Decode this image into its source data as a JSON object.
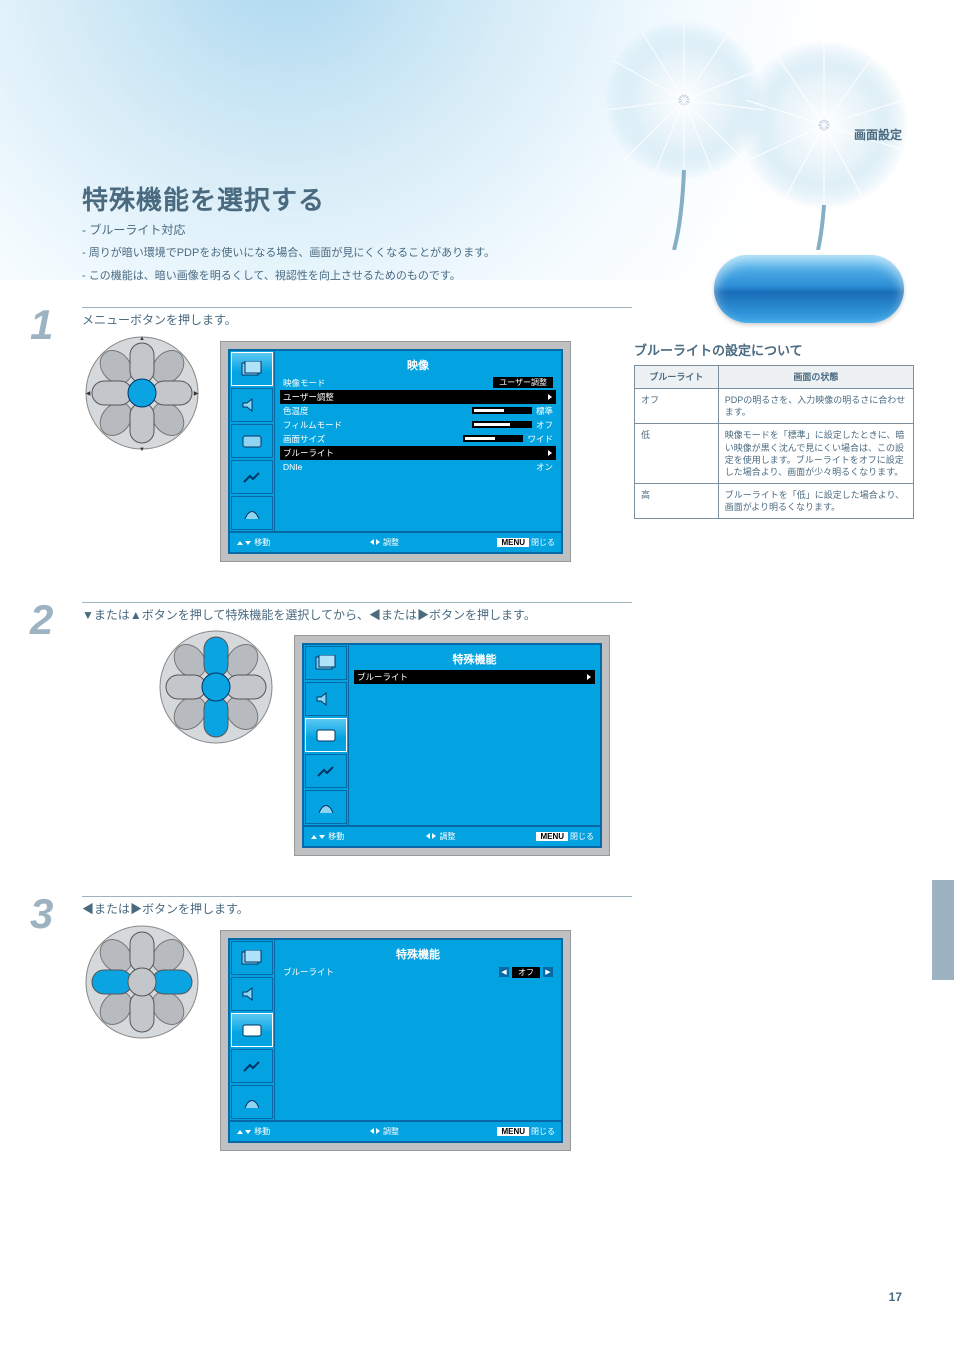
{
  "header": {
    "chapter": "画面設定",
    "page_number": "17"
  },
  "title": {
    "main": "特殊機能を選択する",
    "sub": "- ブルーライト対応",
    "notes": [
      "- 周りが暗い環境でPDPをお使いになる場合、画面が見にくくなることがあります。",
      "- この機能は、暗い画像を明るくして、視認性を向上させるためのものです。"
    ]
  },
  "steps": [
    {
      "num": "1",
      "text": "メニューボタンを押します。",
      "osd": {
        "title": "映像",
        "selected_tab": 0,
        "items": [
          {
            "label": "映像モード",
            "type": "value",
            "value": "ユーザー調整",
            "sel": false
          },
          {
            "label": "ユーザー調整",
            "type": "arrow",
            "sel": true
          },
          {
            "label": "色温度",
            "type": "bar",
            "fill": 50,
            "remark": "標準",
            "sel": false
          },
          {
            "label": "フィルムモード",
            "type": "bar",
            "fill": 60,
            "remark": "オフ",
            "sel": false
          },
          {
            "label": "画面サイズ",
            "type": "bar",
            "fill": 50,
            "remark": "ワイド",
            "sel": false
          },
          {
            "label": "ブルーライト",
            "type": "row",
            "sel": true
          },
          {
            "label": "DNIe",
            "type": "value",
            "value": "オン",
            "sel": false
          }
        ],
        "footer": {
          "move": "移動",
          "adjust": "調整",
          "exit": "閉じる"
        }
      }
    },
    {
      "num": "2",
      "text_parts": [
        "▼または▲ボタン",
        "を押して",
        "特殊機能",
        "を選択してから、",
        "◀または▶ボタン",
        "を押します。"
      ],
      "text": "▼または▲ボタンを押して特殊機能を選択してから、◀または▶ボタンを押します。",
      "osd": {
        "title": "特殊機能",
        "selected_tab": 2,
        "items": [
          {
            "label": "ブルーライト",
            "type": "row",
            "sel": true
          }
        ],
        "footer": {
          "move": "移動",
          "adjust": "調整",
          "exit": "閉じる"
        }
      }
    },
    {
      "num": "3",
      "text": "◀または▶ボタンを押します。",
      "osd": {
        "title": "特殊機能",
        "selected_tab": 2,
        "top_bar": {
          "label": "ブルーライト",
          "value": "オフ"
        },
        "items": [],
        "footer": {
          "move": "移動",
          "adjust": "調整",
          "exit": "閉じる"
        }
      }
    }
  ],
  "sidebar": {
    "title": "ブルーライトの設定について",
    "headers": [
      "ブルーライト",
      "画面の状態"
    ],
    "rows": [
      {
        "mode": "オフ",
        "desc": "PDPの明るさを、入力映像の明るさに合わせます。"
      },
      {
        "mode": "低",
        "desc": "映像モードを「標準」に設定したときに、暗い映像が黒く沈んで見にくい場合は、この設定を使用します。ブルーライトをオフに設定した場合より、画面が少々明るくなります。"
      },
      {
        "mode": "高",
        "desc": "ブルーライトを「低」に設定した場合より、画面がより明るくなります。"
      }
    ]
  }
}
